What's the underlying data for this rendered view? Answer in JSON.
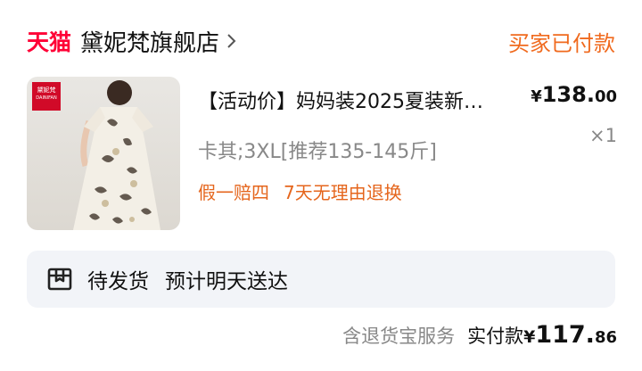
{
  "header": {
    "platform_logo": "天猫",
    "shop_name": "黛妮梵旗舰店",
    "order_status": "买家已付款",
    "colors": {
      "logo": "#ff0036",
      "status": "#f06a1e"
    }
  },
  "product": {
    "image_brand_tag_cn": "黛妮梵",
    "image_brand_tag_en": "DAINIFAN",
    "title": "【活动价】妈妈装2025夏装新…",
    "price_currency": "¥",
    "price_int": "138.",
    "price_dec": "00",
    "sku": "卡其;3XL[推荐135-145斤]",
    "quantity": "×1",
    "guarantees": [
      "假一赔四",
      "7天无理由退换"
    ],
    "guarantee_color": "#e5661d"
  },
  "shipping": {
    "icon": "package-icon",
    "status": "待发货",
    "eta": "预计明天送达"
  },
  "footer": {
    "insurance": "含退货宝服务",
    "paid_label": "实付款",
    "paid_currency": "¥",
    "paid_int": "117.",
    "paid_dec": "86"
  }
}
